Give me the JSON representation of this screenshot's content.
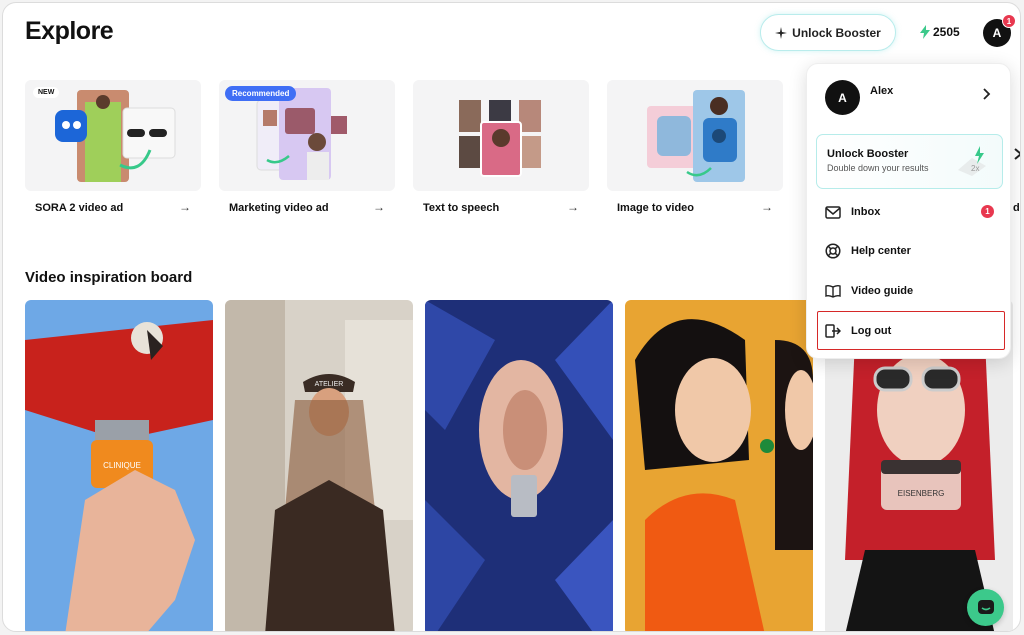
{
  "header": {
    "title": "Explore",
    "unlock_label": "Unlock Booster",
    "credits": "2505",
    "avatar_initial": "A",
    "notification_count": "1"
  },
  "tools": [
    {
      "label": "SORA 2 video ad",
      "badge": "NEW"
    },
    {
      "label": "Marketing video ad",
      "badge": "Recommended"
    },
    {
      "label": "Text to speech",
      "badge": ""
    },
    {
      "label": "Image to video",
      "badge": ""
    }
  ],
  "partial_tool_label": "di",
  "section": {
    "title": "Video inspiration board"
  },
  "inspiration": [
    {
      "subject": "parrot-with-skincare-jar",
      "jar_label": "CLINIQUE"
    },
    {
      "subject": "woman-in-cap-on-street",
      "cap_label": "ATELIER"
    },
    {
      "subject": "ear-with-earring-blue-petals"
    },
    {
      "subject": "women-whispering-orange"
    },
    {
      "subject": "woman-with-sunglasses-jar",
      "jar_label": "EISENBERG"
    }
  ],
  "user_menu": {
    "avatar_initial": "A",
    "name": "Alex",
    "booster_title": "Unlock Booster",
    "booster_subtitle": "Double down your results",
    "booster_multiplier": "2x",
    "items": [
      {
        "label": "Inbox",
        "icon": "mail-icon",
        "badge": "1"
      },
      {
        "label": "Help center",
        "icon": "lifebuoy-icon"
      },
      {
        "label": "Video guide",
        "icon": "book-icon"
      },
      {
        "label": "Log out",
        "icon": "logout-icon"
      }
    ]
  },
  "colors": {
    "accent_teal": "#b9ecec",
    "badge_red": "#e8384f",
    "recommended_blue": "#3f6ef5",
    "chat_green": "#3cc98b",
    "highlight_red": "#d62828"
  }
}
